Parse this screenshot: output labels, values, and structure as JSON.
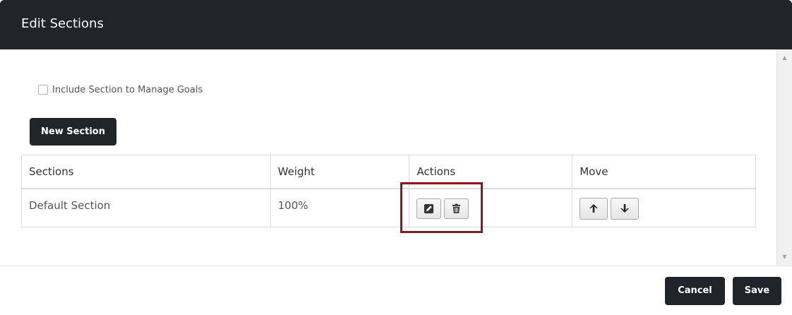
{
  "dialog": {
    "title": "Edit Sections"
  },
  "options": {
    "include_goals_label": "Include Section to Manage Goals",
    "include_goals_checked": false
  },
  "toolbar": {
    "new_section_label": "New Section"
  },
  "table": {
    "headers": [
      "Sections",
      "Weight",
      "Actions",
      "Move"
    ],
    "rows": [
      {
        "section": "Default Section",
        "weight": "100%"
      }
    ],
    "action_icons": [
      "edit-icon",
      "trash-icon"
    ],
    "move_icons": [
      "arrow-up-icon",
      "arrow-down-icon"
    ]
  },
  "footer": {
    "cancel_label": "Cancel",
    "save_label": "Save"
  },
  "colors": {
    "header_bg": "#212529",
    "highlight": "#8b1a1a"
  }
}
